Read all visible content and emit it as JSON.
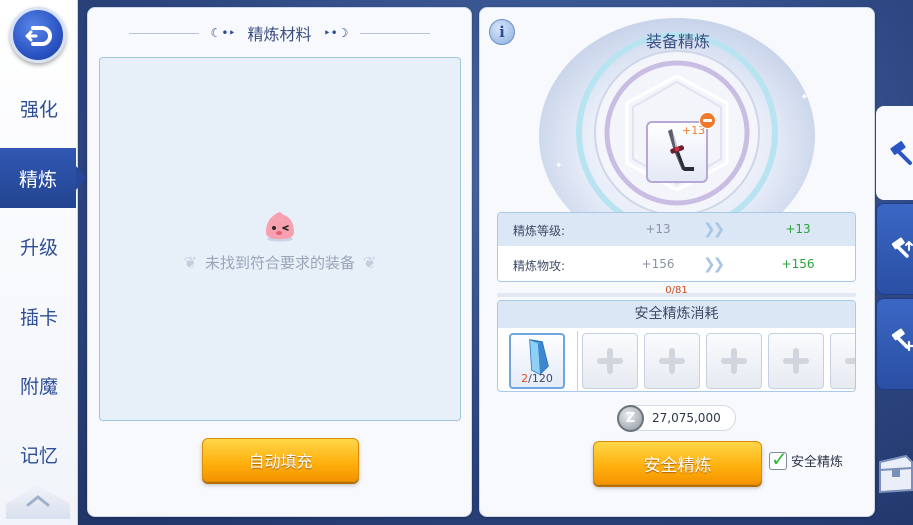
{
  "nav": {
    "items": [
      {
        "label": "强化",
        "active": false
      },
      {
        "label": "精炼",
        "active": true
      },
      {
        "label": "升级",
        "active": false
      },
      {
        "label": "插卡",
        "active": false
      },
      {
        "label": "附魔",
        "active": false
      },
      {
        "label": "记忆",
        "active": false
      }
    ]
  },
  "materials": {
    "title": "精炼材料",
    "empty_text": "未找到符合要求的装备",
    "auto_fill_label": "自动填充"
  },
  "equip": {
    "title": "装备精炼",
    "item_level": "+13",
    "stats": [
      {
        "label": "精炼等级:",
        "current": "+13",
        "next": "+13"
      },
      {
        "label": "精炼物攻:",
        "current": "+156",
        "next": "+156"
      }
    ],
    "progress": {
      "text": "0/81",
      "fraction": 0.0
    },
    "cost": {
      "title": "安全精炼消耗",
      "item_count_have": "2",
      "item_count_sep": "/120"
    },
    "zeny_symbol": "Z",
    "zeny": "27,075,000",
    "safe_refine_label": "安全精炼",
    "safe_check_label": "安全精炼",
    "safe_checked": true
  },
  "colors": {
    "accent": "#2b55c4",
    "button_orange": "#ffb20f",
    "next_value_green": "#29a33a",
    "warning_orange": "#f0792e"
  },
  "icons": {
    "back": "back-arrow-icon",
    "info": "info-icon",
    "material": "blue-crystal-icon",
    "weapon": "dagger-icon",
    "tabs": [
      "hammer-icon",
      "hammer-upgrade-icon",
      "hammer-plus-icon"
    ],
    "chest": "chest-icon"
  }
}
